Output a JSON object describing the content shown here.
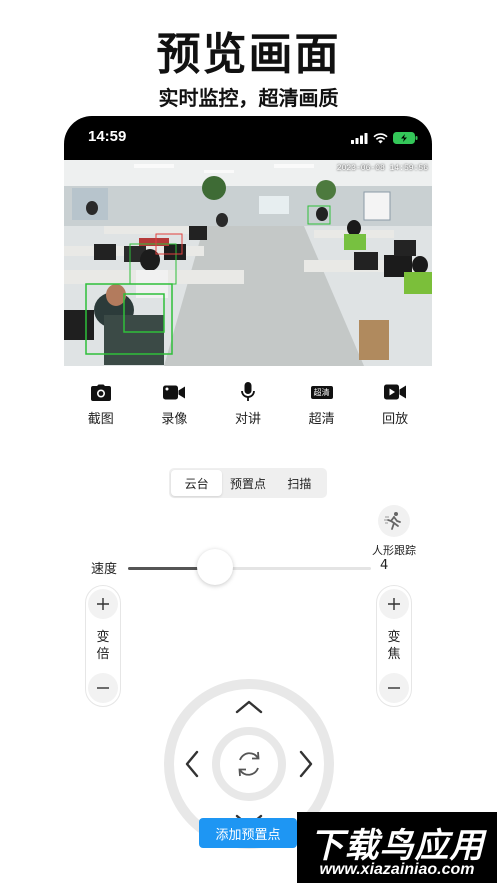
{
  "promo": {
    "title": "预览画面",
    "subtitle": "实时监控，超清画质"
  },
  "status_bar": {
    "time": "14:59",
    "icons": [
      "signal-icon",
      "wifi-icon",
      "battery-charging-icon"
    ],
    "battery_color": "#34c759"
  },
  "video": {
    "timestamp": "2023-06-08 14:59:56"
  },
  "toolbar": {
    "items": [
      {
        "label": "截图",
        "icon": "camera-icon"
      },
      {
        "label": "录像",
        "icon": "video-camera-icon"
      },
      {
        "label": "对讲",
        "icon": "microphone-icon"
      },
      {
        "label": "超清",
        "icon": "hd-badge-icon",
        "badge": "超清"
      },
      {
        "label": "回放",
        "icon": "playback-icon"
      }
    ]
  },
  "control_tabs": {
    "tabs": [
      "云台",
      "预置点",
      "扫描"
    ],
    "active": "云台"
  },
  "tracking": {
    "label": "人形跟踪",
    "icon": "running-person-icon"
  },
  "zoom": {
    "label": "变倍",
    "plus": "+",
    "minus": "−"
  },
  "focus": {
    "label": "变焦",
    "plus": "+",
    "minus": "−"
  },
  "dpad": {
    "icons": [
      "arrow-up-icon",
      "arrow-down-icon",
      "arrow-left-icon",
      "arrow-right-icon",
      "refresh-icon"
    ]
  },
  "speed": {
    "label": "速度",
    "value": "4",
    "fraction": 0.36
  },
  "buttons": {
    "add_preset": "添加预置点"
  },
  "watermark": {
    "text": "下载鸟应用",
    "url": "www.xiazainiao.com"
  },
  "colors": {
    "accent": "#1e96f3",
    "detection_box": "#2fbf3a",
    "person_box": "#e0403d"
  }
}
